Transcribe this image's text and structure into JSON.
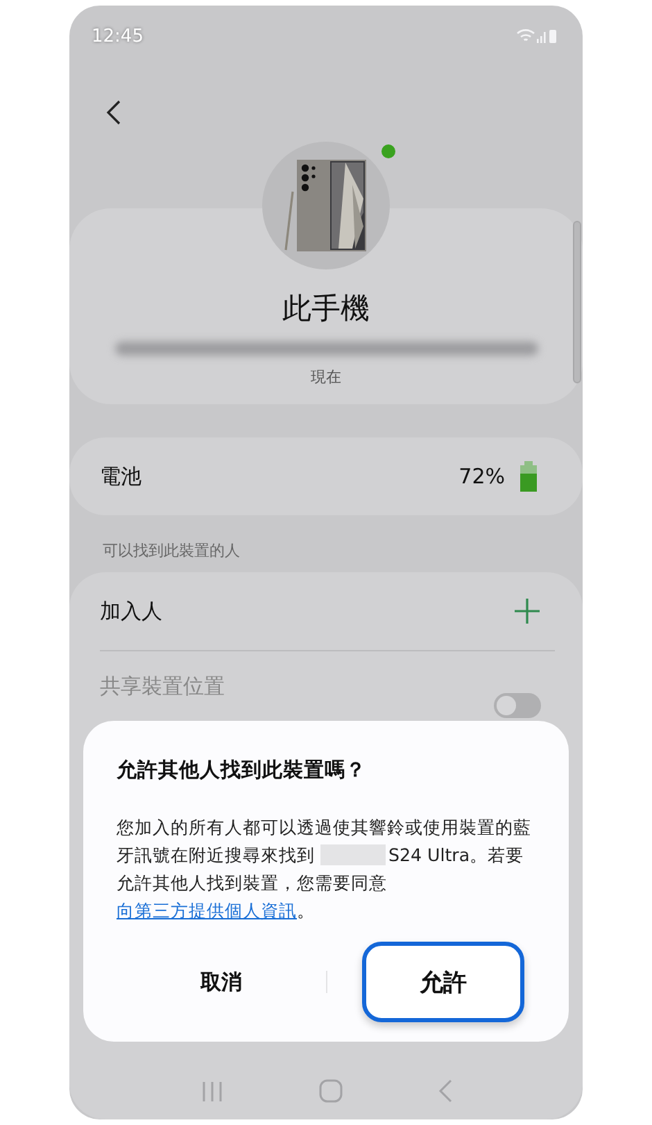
{
  "status_bar": {
    "time": "12:45"
  },
  "device": {
    "name": "此手機",
    "last_seen": "現在",
    "online": true
  },
  "battery": {
    "label": "電池",
    "value": "72%"
  },
  "section_label": "可以找到此裝置的人",
  "people": {
    "add_label": "加入人",
    "share": {
      "label": "共享裝置位置",
      "on": false
    }
  },
  "dialog": {
    "title": "允許其他人找到此裝置嗎？",
    "body_before": "您加入的所有人都可以透過使其響鈴或使用裝置的藍牙訊號在附近搜尋來找到",
    "body_after": "S24 Ultra。若要允許其他人找到裝置，您需要同意",
    "link": "向第三方提供個人資訊",
    "body_end": "。",
    "buttons": [
      {
        "label": "取消",
        "focused": false
      },
      {
        "label": "允許",
        "focused": true
      }
    ]
  }
}
